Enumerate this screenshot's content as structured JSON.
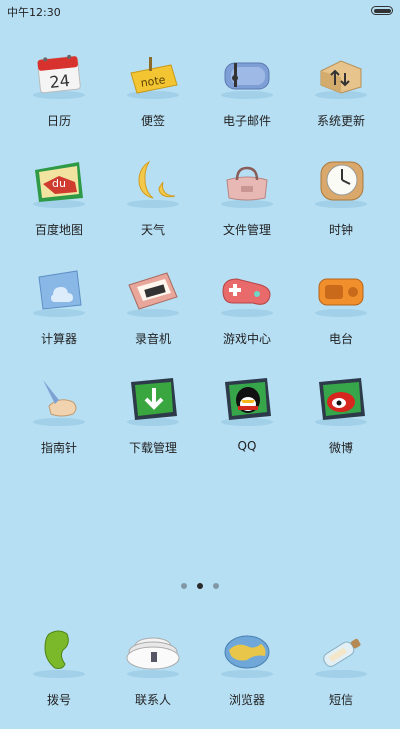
{
  "status_bar": {
    "time": "中午12:30"
  },
  "apps": [
    {
      "label": "日历",
      "icon": "calendar-icon"
    },
    {
      "label": "便签",
      "icon": "notes-icon"
    },
    {
      "label": "电子邮件",
      "icon": "mail-icon"
    },
    {
      "label": "系统更新",
      "icon": "update-icon"
    },
    {
      "label": "百度地图",
      "icon": "baidu-map-icon"
    },
    {
      "label": "天气",
      "icon": "weather-icon"
    },
    {
      "label": "文件管理",
      "icon": "file-manager-icon"
    },
    {
      "label": "时钟",
      "icon": "clock-icon"
    },
    {
      "label": "计算器",
      "icon": "calculator-icon"
    },
    {
      "label": "录音机",
      "icon": "recorder-icon"
    },
    {
      "label": "游戏中心",
      "icon": "game-center-icon"
    },
    {
      "label": "电台",
      "icon": "radio-icon"
    },
    {
      "label": "指南针",
      "icon": "compass-icon"
    },
    {
      "label": "下载管理",
      "icon": "download-icon"
    },
    {
      "label": "QQ",
      "icon": "qq-icon"
    },
    {
      "label": "微博",
      "icon": "weibo-icon"
    }
  ],
  "dock": [
    {
      "label": "拨号",
      "icon": "phone-icon"
    },
    {
      "label": "联系人",
      "icon": "contacts-icon"
    },
    {
      "label": "浏览器",
      "icon": "browser-icon"
    },
    {
      "label": "短信",
      "icon": "messages-icon"
    }
  ],
  "calendar_day": "24",
  "notes_text": "note",
  "baidu_text": "du",
  "page_indicator": {
    "count": 3,
    "active": 2
  }
}
